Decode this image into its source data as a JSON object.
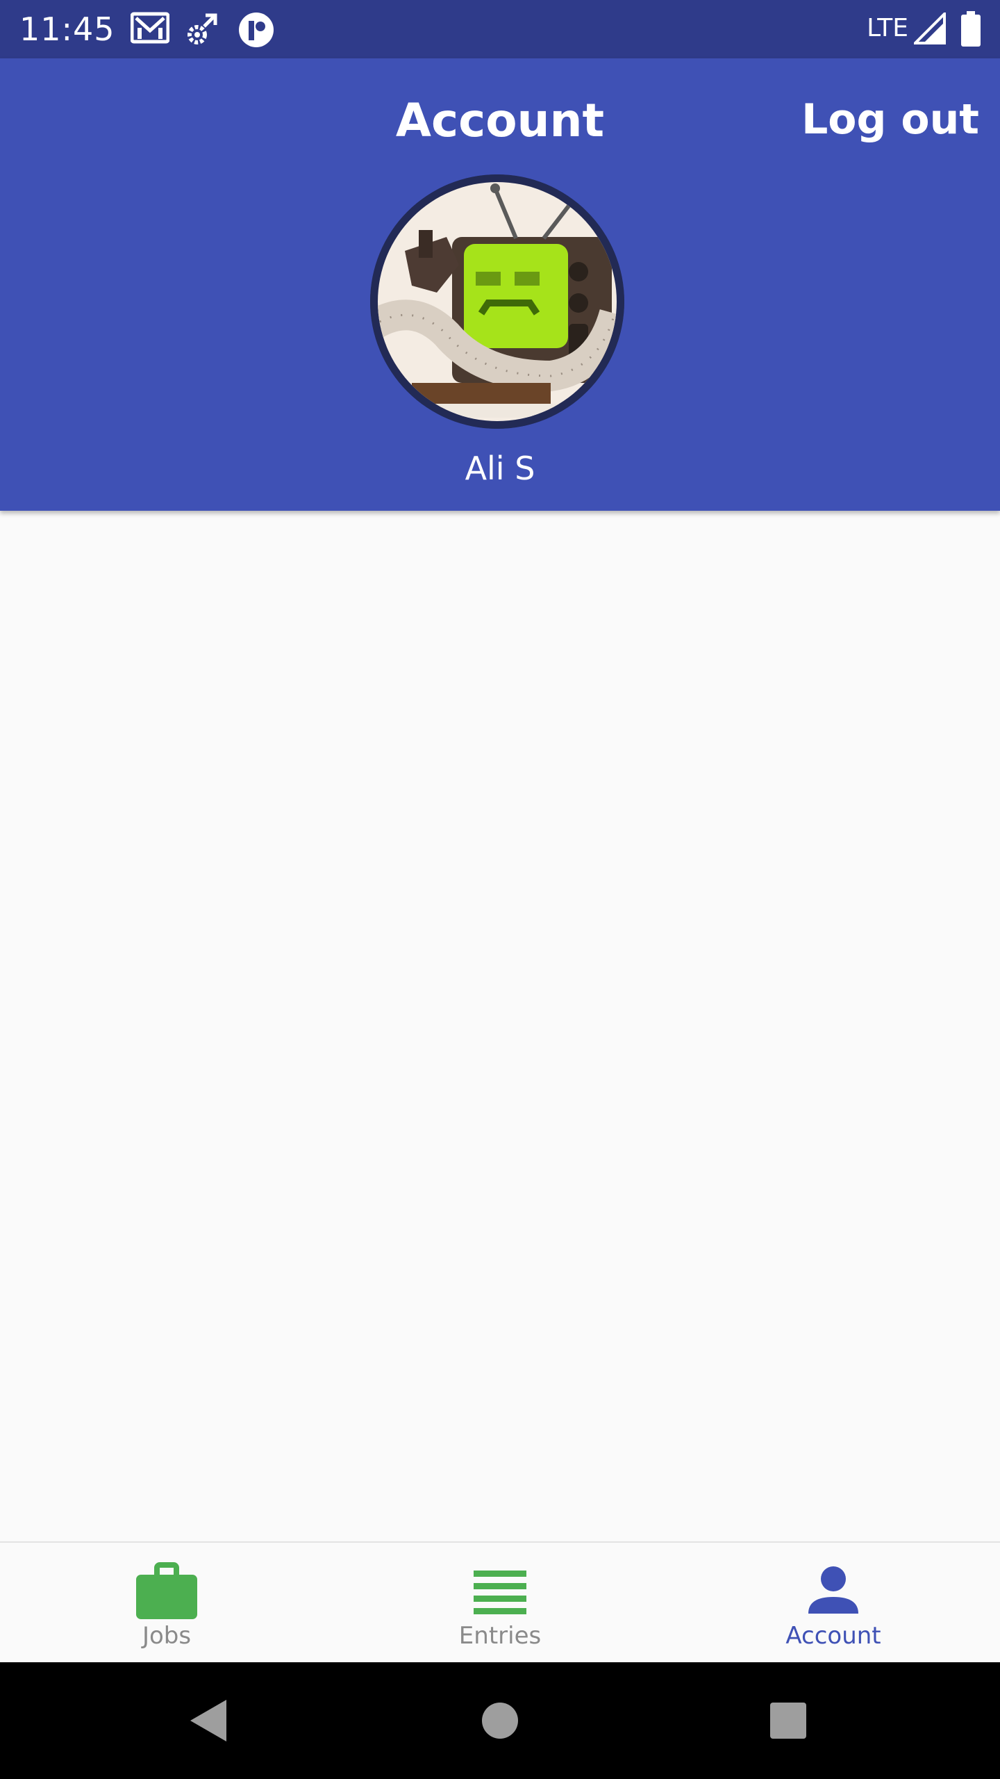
{
  "status_bar": {
    "time": "11:45",
    "network": "LTE",
    "icons": [
      "gmail-icon",
      "settings-sync-icon",
      "app-notification-icon",
      "signal-icon",
      "battery-icon"
    ]
  },
  "header": {
    "title": "Account",
    "logout_label": "Log out",
    "avatar_icon": "avatar",
    "user_name": "Ali S"
  },
  "bottom_nav": {
    "items": [
      {
        "label": "Jobs",
        "icon": "briefcase-icon",
        "active": false
      },
      {
        "label": "Entries",
        "icon": "list-icon",
        "active": false
      },
      {
        "label": "Account",
        "icon": "person-icon",
        "active": true
      }
    ]
  },
  "system_nav": {
    "buttons": [
      "back-icon",
      "home-icon",
      "recents-icon"
    ]
  },
  "colors": {
    "primary": "#3f51b5",
    "primary_dark": "#2f3b8a",
    "accent_green": "#4caf50",
    "background": "#fafafa",
    "inactive_label": "#8a8a8a"
  }
}
